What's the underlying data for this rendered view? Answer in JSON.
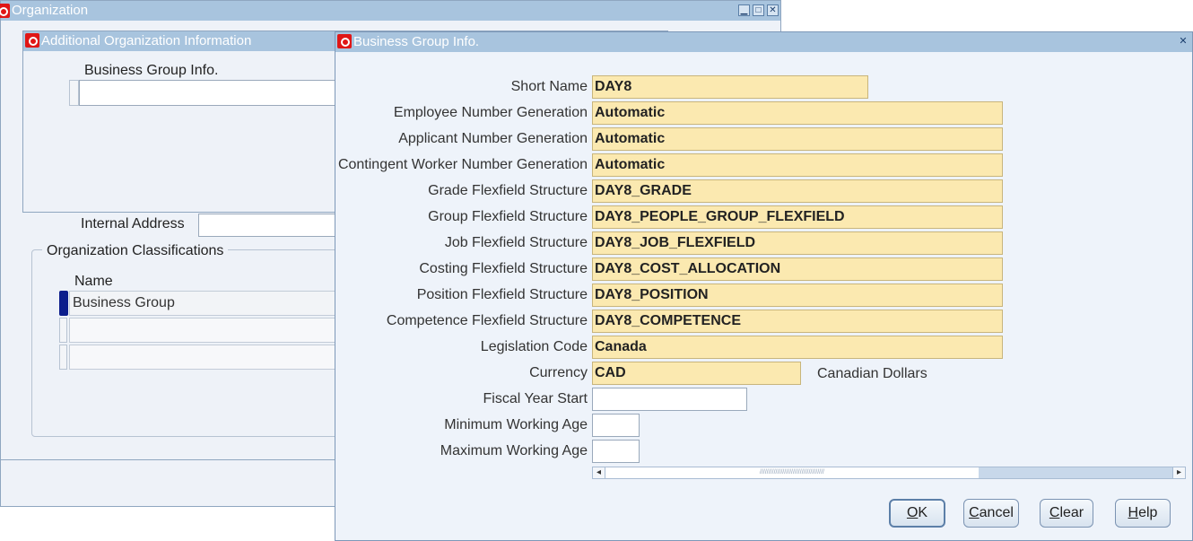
{
  "organization_window": {
    "title": "Organization",
    "controls": [
      "▁",
      "□",
      "✕"
    ],
    "internal_address_label": "Internal Address",
    "classifications": {
      "group_label": "Organization Classifications",
      "column_name": "Name",
      "rows": [
        "Business Group",
        "",
        ""
      ]
    }
  },
  "additional_info_window": {
    "title": "Additional Organization Information",
    "column_header": "Business Group Info."
  },
  "bg_window": {
    "title": "Business Group Info.",
    "close": "✕",
    "fields": [
      {
        "label": "Short Name",
        "value": "DAY8"
      },
      {
        "label": "Employee Number Generation",
        "value": "Automatic"
      },
      {
        "label": "Applicant Number Generation",
        "value": "Automatic"
      },
      {
        "label": "Contingent Worker Number Generation",
        "value": "Automatic"
      },
      {
        "label": "Grade Flexfield Structure",
        "value": "DAY8_GRADE"
      },
      {
        "label": "Group Flexfield Structure",
        "value": "DAY8_PEOPLE_GROUP_FLEXFIELD"
      },
      {
        "label": "Job Flexfield Structure",
        "value": "DAY8_JOB_FLEXFIELD"
      },
      {
        "label": "Costing Flexfield Structure",
        "value": "DAY8_COST_ALLOCATION"
      },
      {
        "label": "Position Flexfield Structure",
        "value": "DAY8_POSITION"
      },
      {
        "label": "Competence Flexfield Structure",
        "value": "DAY8_COMPETENCE"
      },
      {
        "label": "Legislation Code",
        "value": "Canada"
      },
      {
        "label": "Currency",
        "value": "CAD"
      },
      {
        "label": "Fiscal Year Start",
        "value": ""
      },
      {
        "label": "Minimum Working Age",
        "value": ""
      },
      {
        "label": "Maximum Working Age",
        "value": ""
      }
    ],
    "currency_description": "Canadian Dollars",
    "scrollbar": {
      "left_arrow": "◂",
      "right_arrow": "▸"
    },
    "buttons": {
      "ok": {
        "mnemonic": "O",
        "rest": "K"
      },
      "cancel": {
        "mnemonic": "C",
        "rest": "ancel"
      },
      "clear": {
        "mnemonic": "C",
        "rest": "lear"
      },
      "help": {
        "mnemonic": "H",
        "rest": "elp"
      }
    }
  }
}
